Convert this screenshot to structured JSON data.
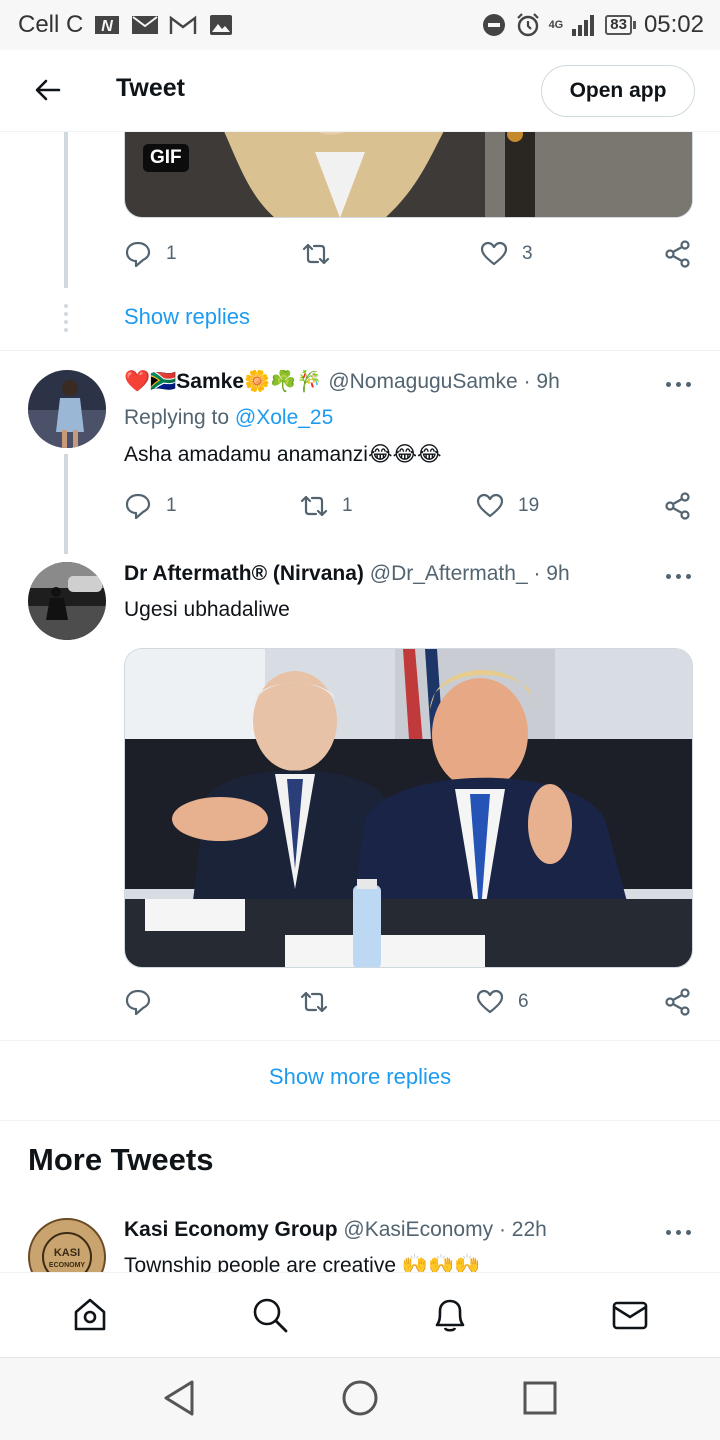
{
  "status_bar": {
    "carrier": "Cell C",
    "network": "4G",
    "battery": "83",
    "time": "05:02",
    "icons": [
      "n-icon",
      "mail-icon",
      "gmail-icon",
      "image-icon",
      "dnd-icon",
      "alarm-icon",
      "signal-icon",
      "battery-icon"
    ]
  },
  "header": {
    "title": "Tweet",
    "open_app_label": "Open app",
    "back_icon": "arrow-left-icon"
  },
  "prev_tweet": {
    "gif_label": "GIF",
    "replies": "1",
    "retweets": "",
    "likes": "3",
    "show_replies_label": "Show replies"
  },
  "tweets": [
    {
      "name": "Samke",
      "name_emoji_prefix": "❤️🇿🇦",
      "name_emoji_suffix": "🌼☘️🎋",
      "handle": "@NomaguguSamke",
      "time": "· 9h",
      "replying_prefix": "Replying to",
      "replying_to": "@Xole_25",
      "text": "Asha amadamu anamanzi😂😂😂",
      "replies": "1",
      "retweets": "1",
      "likes": "19"
    },
    {
      "name": "Dr Aftermath® (Nirvana)",
      "handle": "@Dr_Aftermath_",
      "time": "· 9h",
      "text": "Ugesi ubhadaliwe",
      "replies": "",
      "retweets": "",
      "likes": "6"
    }
  ],
  "show_more_replies_label": "Show more replies",
  "more_tweets": {
    "title": "More Tweets",
    "tweet": {
      "name": "Kasi Economy Group",
      "handle": "@KasiEconomy",
      "time": "· 22h",
      "text": "Township people are creative 🙌🙌🙌",
      "avatar_text_1": "KASI",
      "avatar_text_2": "ECONOMY"
    }
  },
  "bottom_nav": [
    "home-icon",
    "search-icon",
    "bell-icon",
    "mail-icon"
  ],
  "colors": {
    "accent": "#1d9bf0",
    "text": "#0f1419",
    "muted": "#536471",
    "border": "#cfd9de"
  }
}
